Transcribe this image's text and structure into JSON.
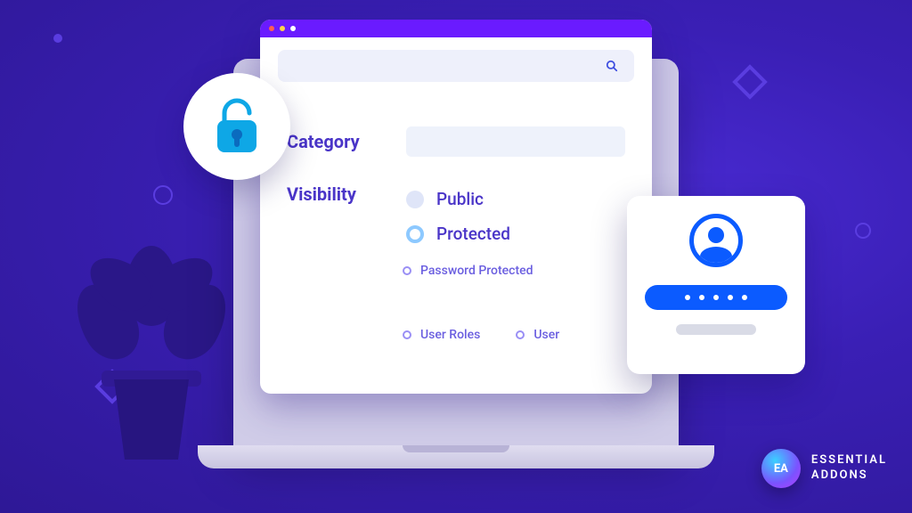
{
  "form": {
    "category_label": "Category",
    "visibility_label": "Visibility",
    "options": {
      "public": "Public",
      "protected": "Protected"
    },
    "sub_options": {
      "password_protected": "Password Protected",
      "user_roles": "User Roles",
      "user": "User"
    }
  },
  "brand": {
    "icon_text": "EA",
    "line1": "ESSENTIAL",
    "line2": "ADDONS"
  }
}
